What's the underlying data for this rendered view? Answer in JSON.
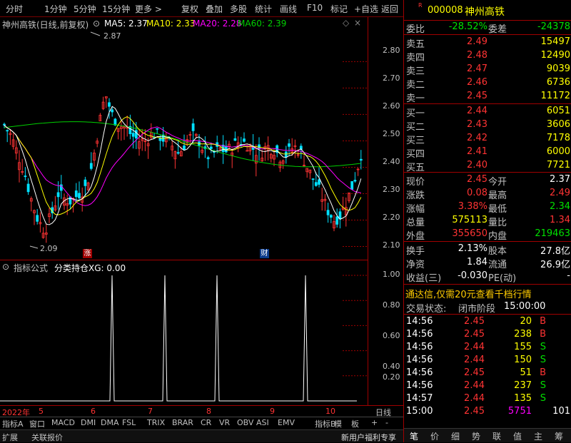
{
  "toolbar": {
    "items": [
      "分时",
      "1分钟",
      "5分钟",
      "15分钟",
      "更多 >",
      "复权",
      "叠加",
      "多股",
      "统计",
      "画线",
      "F10",
      "标记",
      "+自选",
      "返回"
    ]
  },
  "chart_header": {
    "name": "神州高铁(日线,前复权)",
    "ma5": "MA5: 2.37",
    "ma10": "MA10: 2.33",
    "ma20": "MA20: 2.28",
    "ma60": "MA60: 2.39",
    "high_label": "2.87",
    "low_label": "2.09",
    "badge_up": "涨",
    "badge_fin": "财"
  },
  "colors": {
    "up": "#ff3333",
    "down": "#00e0ff",
    "ma5": "#ffffff",
    "ma10": "#ffff00",
    "ma20": "#ff00ff",
    "ma60": "#00d000",
    "grid": "#a00000"
  },
  "price_axis": {
    "ticks": [
      "2.80",
      "2.70",
      "2.60",
      "2.50",
      "2.40",
      "2.30",
      "2.20",
      "2.10"
    ]
  },
  "lower_header": {
    "title": "指标公式",
    "formula": "分类持仓XG: 0.00"
  },
  "lower_axis": {
    "ticks": [
      "1.00",
      "0.80",
      "0.60",
      "0.40",
      "0.20"
    ]
  },
  "date_axis": {
    "labels": [
      "2022年",
      "5",
      "6",
      "7",
      "8",
      "9",
      "10"
    ],
    "right_label": "日线"
  },
  "tabs": [
    "指标A",
    "窗口",
    "MACD",
    "DMI",
    "DMA",
    "FSL",
    "TRIX",
    "BRAR",
    "CR",
    "VR",
    "OBV",
    "ASI",
    "EMV",
    "指标B",
    "模",
    "板",
    "+",
    "-"
  ],
  "bottom": {
    "left1": "扩展",
    "left2": "关联报价",
    "right": "新用户福利专享"
  },
  "quote": {
    "code": "000008",
    "name": "神州高铁",
    "r_badge": "R",
    "weibi_label": "委比",
    "weibi": "-28.52%",
    "weicha_label": "委差",
    "weicha": "-24378",
    "asks": [
      {
        "label": "卖五",
        "price": "2.49",
        "vol": "15497"
      },
      {
        "label": "卖四",
        "price": "2.48",
        "vol": "12490"
      },
      {
        "label": "卖三",
        "price": "2.47",
        "vol": "9039"
      },
      {
        "label": "卖二",
        "price": "2.46",
        "vol": "6736"
      },
      {
        "label": "卖一",
        "price": "2.45",
        "vol": "11172"
      }
    ],
    "bids": [
      {
        "label": "买一",
        "price": "2.44",
        "vol": "6051"
      },
      {
        "label": "买二",
        "price": "2.43",
        "vol": "3606"
      },
      {
        "label": "买三",
        "price": "2.42",
        "vol": "7178"
      },
      {
        "label": "买四",
        "price": "2.41",
        "vol": "6000"
      },
      {
        "label": "买五",
        "price": "2.40",
        "vol": "7721"
      }
    ],
    "stats": [
      {
        "l1": "现价",
        "v1": "2.45",
        "c1": "red",
        "l2": "今开",
        "v2": "2.37",
        "c2": "white"
      },
      {
        "l1": "涨跌",
        "v1": "0.08",
        "c1": "red",
        "l2": "最高",
        "v2": "2.49",
        "c2": "red"
      },
      {
        "l1": "涨幅",
        "v1": "3.38%",
        "c1": "red",
        "l2": "最低",
        "v2": "2.34",
        "c2": "green"
      },
      {
        "l1": "总量",
        "v1": "575113",
        "c1": "yellow",
        "l2": "量比",
        "v2": "1.34",
        "c2": "red"
      },
      {
        "l1": "外盘",
        "v1": "355650",
        "c1": "red",
        "l2": "内盘",
        "v2": "219463",
        "c2": "green"
      }
    ],
    "stats2": [
      {
        "l1": "换手",
        "v1": "2.13%",
        "l2": "股本",
        "v2": "27.8亿"
      },
      {
        "l1": "净资",
        "v1": "1.84",
        "l2": "流通",
        "v2": "26.9亿"
      },
      {
        "l1": "收益(三)",
        "v1": "-0.030",
        "l2": "PE(动)",
        "v2": "-"
      }
    ],
    "promo": "通达信,仅需20元查看千档行情",
    "status_label": "交易状态:",
    "status": "闭市阶段",
    "status_time": "15:00:00",
    "ticks": [
      {
        "t": "14:56",
        "p": "2.45",
        "pc": "red",
        "v": "20",
        "d": "B"
      },
      {
        "t": "14:56",
        "p": "2.45",
        "pc": "red",
        "v": "238",
        "d": "B"
      },
      {
        "t": "14:56",
        "p": "2.44",
        "pc": "red",
        "v": "155",
        "d": "S"
      },
      {
        "t": "14:56",
        "p": "2.44",
        "pc": "red",
        "v": "150",
        "d": "S"
      },
      {
        "t": "14:56",
        "p": "2.45",
        "pc": "red",
        "v": "51",
        "d": "B"
      },
      {
        "t": "14:56",
        "p": "2.44",
        "pc": "red",
        "v": "237",
        "d": "S"
      },
      {
        "t": "14:57",
        "p": "2.44",
        "pc": "red",
        "v": "135",
        "d": "S"
      },
      {
        "t": "15:00",
        "p": "2.45",
        "pc": "red",
        "v": "5751",
        "d": "101"
      }
    ],
    "bottom_tabs": [
      "笔",
      "价",
      "细",
      "势",
      "联",
      "值",
      "主",
      "筹"
    ]
  }
}
